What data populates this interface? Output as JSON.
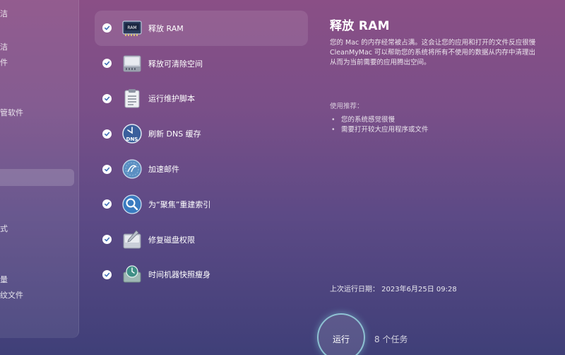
{
  "sidebar": {
    "fragments": [
      "",
      "洁",
      "件",
      "管软件",
      "式",
      "量",
      "纹文件"
    ]
  },
  "tasks": [
    {
      "label": "释放 RAM",
      "icon": "ram-chip-icon",
      "checked": true,
      "selected": true
    },
    {
      "label": "释放可清除空间",
      "icon": "disk-drive-icon",
      "checked": true,
      "selected": false
    },
    {
      "label": "运行维护脚本",
      "icon": "clipboard-script-icon",
      "checked": true,
      "selected": false
    },
    {
      "label": "刷新 DNS 缓存",
      "icon": "dns-clock-icon",
      "checked": true,
      "selected": false
    },
    {
      "label": "加速邮件",
      "icon": "mail-stamp-icon",
      "checked": true,
      "selected": false
    },
    {
      "label": "为“聚焦”重建索引",
      "icon": "spotlight-search-icon",
      "checked": true,
      "selected": false
    },
    {
      "label": "修复磁盘权限",
      "icon": "disk-repair-icon",
      "checked": true,
      "selected": false
    },
    {
      "label": "时间机器快照瘦身",
      "icon": "time-machine-icon",
      "checked": true,
      "selected": false
    }
  ],
  "detail": {
    "title": "释放 RAM",
    "description_lines": [
      "您的 Mac 的内存经常被占满。这会让您的应用和打开的文件反应很慢",
      "CleanMyMac 可以帮助您的系统将所有不使用的数据从内存中清理出",
      "从而为当前需要的应用腾出空间。"
    ],
    "recommend_title": "使用推荐：",
    "recommend_items": [
      "您的系统感觉很慢",
      "需要打开较大应用程序或文件"
    ],
    "last_run": "上次运行日期： 2023年6月25日 09:28"
  },
  "footer": {
    "run_label": "运行",
    "task_count": "8 个任务"
  },
  "colors": {
    "accent_check": "#3d6fb8",
    "run_ring": "#a0e6eb"
  }
}
